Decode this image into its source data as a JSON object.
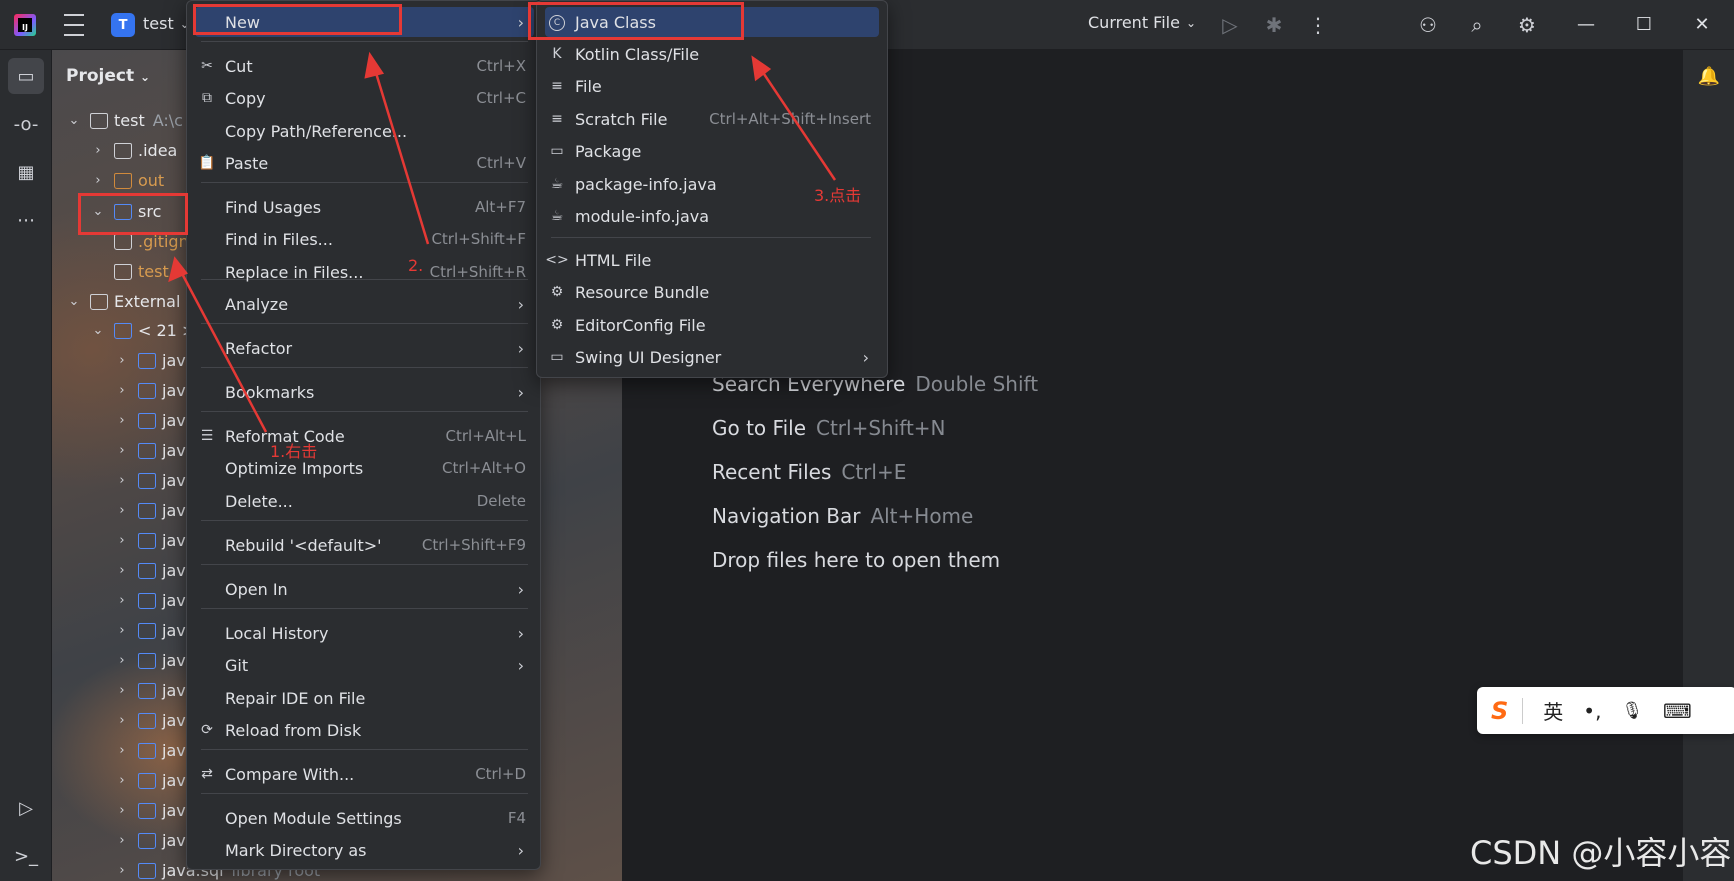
{
  "titlebar": {
    "project_badge": "T",
    "project_name": "test",
    "run_config": "Current File",
    "minimize": "—",
    "maximize": "☐",
    "close": "✕"
  },
  "project_panel": {
    "title": "Project",
    "tree": [
      {
        "label": "test",
        "hint": "A:\\c",
        "icon": "module-icon"
      },
      {
        "label": ".idea",
        "icon": "folder-icon"
      },
      {
        "label": "out",
        "icon": "folder-icon",
        "color": "orange"
      },
      {
        "label": "src",
        "icon": "folder-icon",
        "color": "blue"
      },
      {
        "label": ".gitign",
        "icon": "ignore-file-icon",
        "color": "orange"
      },
      {
        "label": "test.i",
        "icon": "file-icon",
        "color": "orange"
      },
      {
        "label": "External",
        "icon": "library-icon"
      },
      {
        "label": "< 21 >",
        "icon": "jdk-icon"
      },
      {
        "label": "java"
      },
      {
        "label": "java"
      },
      {
        "label": "java"
      },
      {
        "label": "java"
      },
      {
        "label": "java"
      },
      {
        "label": "java"
      },
      {
        "label": "java"
      },
      {
        "label": "java"
      },
      {
        "label": "java"
      },
      {
        "label": "java"
      },
      {
        "label": "java"
      },
      {
        "label": "java"
      },
      {
        "label": "java"
      },
      {
        "label": "java"
      },
      {
        "label": "java"
      },
      {
        "label": "java"
      },
      {
        "label": "java"
      },
      {
        "label": "java.sql",
        "hint": "library root"
      }
    ]
  },
  "context_menu": {
    "items": [
      {
        "label": "New",
        "arrow": "›"
      },
      {
        "label": "Cut",
        "shortcut": "Ctrl+X",
        "icon": "scissors-icon"
      },
      {
        "label": "Copy",
        "shortcut": "Ctrl+C",
        "icon": "copy-icon"
      },
      {
        "label": "Copy Path/Reference..."
      },
      {
        "label": "Paste",
        "shortcut": "Ctrl+V",
        "icon": "paste-icon"
      },
      {
        "label": "Find Usages",
        "shortcut": "Alt+F7"
      },
      {
        "label": "Find in Files...",
        "shortcut": "Ctrl+Shift+F"
      },
      {
        "label": "Replace in Files...",
        "shortcut": "Ctrl+Shift+R"
      },
      {
        "label": "Analyze",
        "arrow": "›"
      },
      {
        "label": "Refactor",
        "arrow": "›"
      },
      {
        "label": "Bookmarks",
        "arrow": "›"
      },
      {
        "label": "Reformat Code",
        "shortcut": "Ctrl+Alt+L",
        "icon": "reformat-icon"
      },
      {
        "label": "Optimize Imports",
        "shortcut": "Ctrl+Alt+O"
      },
      {
        "label": "Delete...",
        "shortcut": "Delete"
      },
      {
        "label": "Rebuild '<default>'",
        "shortcut": "Ctrl+Shift+F9"
      },
      {
        "label": "Open In",
        "arrow": "›"
      },
      {
        "label": "Local History",
        "arrow": "›"
      },
      {
        "label": "Git",
        "arrow": "›"
      },
      {
        "label": "Repair IDE on File"
      },
      {
        "label": "Reload from Disk",
        "icon": "reload-icon"
      },
      {
        "label": "Compare With...",
        "shortcut": "Ctrl+D",
        "icon": "compare-icon"
      },
      {
        "label": "Open Module Settings",
        "shortcut": "F4"
      },
      {
        "label": "Mark Directory as",
        "arrow": "›"
      }
    ]
  },
  "new_submenu": {
    "items": [
      {
        "label": "Java Class",
        "icon": "C"
      },
      {
        "label": "Kotlin Class/File",
        "icon": "K"
      },
      {
        "label": "File",
        "icon": "≡"
      },
      {
        "label": "Scratch File",
        "shortcut": "Ctrl+Alt+Shift+Insert",
        "icon": "≡"
      },
      {
        "label": "Package",
        "icon": "▭"
      },
      {
        "label": "package-info.java",
        "icon": "☕"
      },
      {
        "label": "module-info.java",
        "icon": "☕"
      },
      {
        "label": "HTML File",
        "icon": "<>"
      },
      {
        "label": "Resource Bundle",
        "icon": "⚙"
      },
      {
        "label": "EditorConfig File",
        "icon": "⚙"
      },
      {
        "label": "Swing UI Designer",
        "icon": "▭",
        "arrow": "›"
      }
    ]
  },
  "editor_tips": [
    {
      "label": "Search Everywhere",
      "shortcut": "Double Shift"
    },
    {
      "label": "Go to File",
      "shortcut": "Ctrl+Shift+N"
    },
    {
      "label": "Recent Files",
      "shortcut": "Ctrl+E"
    },
    {
      "label": "Navigation Bar",
      "shortcut": "Alt+Home"
    },
    {
      "label": "Drop files here to open them",
      "shortcut": ""
    }
  ],
  "annotations": {
    "step1": "1.右击",
    "step2": "2.",
    "step3": "3.点击",
    "color": "#e53935"
  },
  "ime_bar": {
    "logo": "S",
    "lang": "英",
    "punct": "•,",
    "mic": "🎙",
    "keyboard": "⌨"
  },
  "watermark": "CSDN @小容小容",
  "colors": {
    "accent": "#3574f0",
    "selection": "#2e436e",
    "background": "#1e1f22",
    "panel": "#2b2d30"
  }
}
